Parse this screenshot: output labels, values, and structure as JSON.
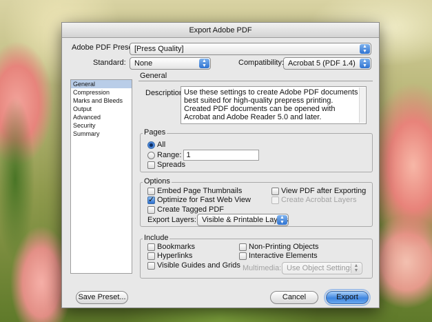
{
  "dialog": {
    "title": "Export Adobe PDF",
    "preset_label": "Adobe PDF Preset:",
    "preset_value": "[Press Quality]",
    "standard_label": "Standard:",
    "standard_value": "None",
    "compat_label": "Compatibility:",
    "compat_value": "Acrobat 5 (PDF 1.4)"
  },
  "sidebar": {
    "items": [
      {
        "label": "General",
        "selected": true
      },
      {
        "label": "Compression"
      },
      {
        "label": "Marks and Bleeds"
      },
      {
        "label": "Output"
      },
      {
        "label": "Advanced"
      },
      {
        "label": "Security"
      },
      {
        "label": "Summary"
      }
    ]
  },
  "general": {
    "section_title": "General",
    "description_label": "Description:",
    "description_text": "Use these settings to create Adobe PDF documents best suited for high-quality prepress printing.  Created PDF documents can be opened with Acrobat and Adobe Reader 5.0 and later."
  },
  "pages": {
    "title": "Pages",
    "all_label": "All",
    "all_checked": true,
    "range_label": "Range:",
    "range_value": "1",
    "spreads_label": "Spreads"
  },
  "options": {
    "title": "Options",
    "embed_thumbnails": "Embed Page Thumbnails",
    "optimize_web": "Optimize for Fast Web View",
    "optimize_checked": true,
    "tagged_pdf": "Create Tagged PDF",
    "view_after": "View PDF after Exporting",
    "acrobat_layers": "Create Acrobat Layers",
    "export_layers_label": "Export Layers:",
    "export_layers_value": "Visible & Printable Layers"
  },
  "include": {
    "title": "Include",
    "bookmarks": "Bookmarks",
    "hyperlinks": "Hyperlinks",
    "guides_grids": "Visible Guides and Grids",
    "non_printing": "Non-Printing Objects",
    "interactive": "Interactive Elements",
    "multimedia_label": "Multimedia:",
    "multimedia_value": "Use Object Settings"
  },
  "buttons": {
    "save_preset": "Save Preset...",
    "cancel": "Cancel",
    "export": "Export"
  },
  "colors": {
    "accent": "#3f86e0",
    "selection": "#b9cde8"
  }
}
